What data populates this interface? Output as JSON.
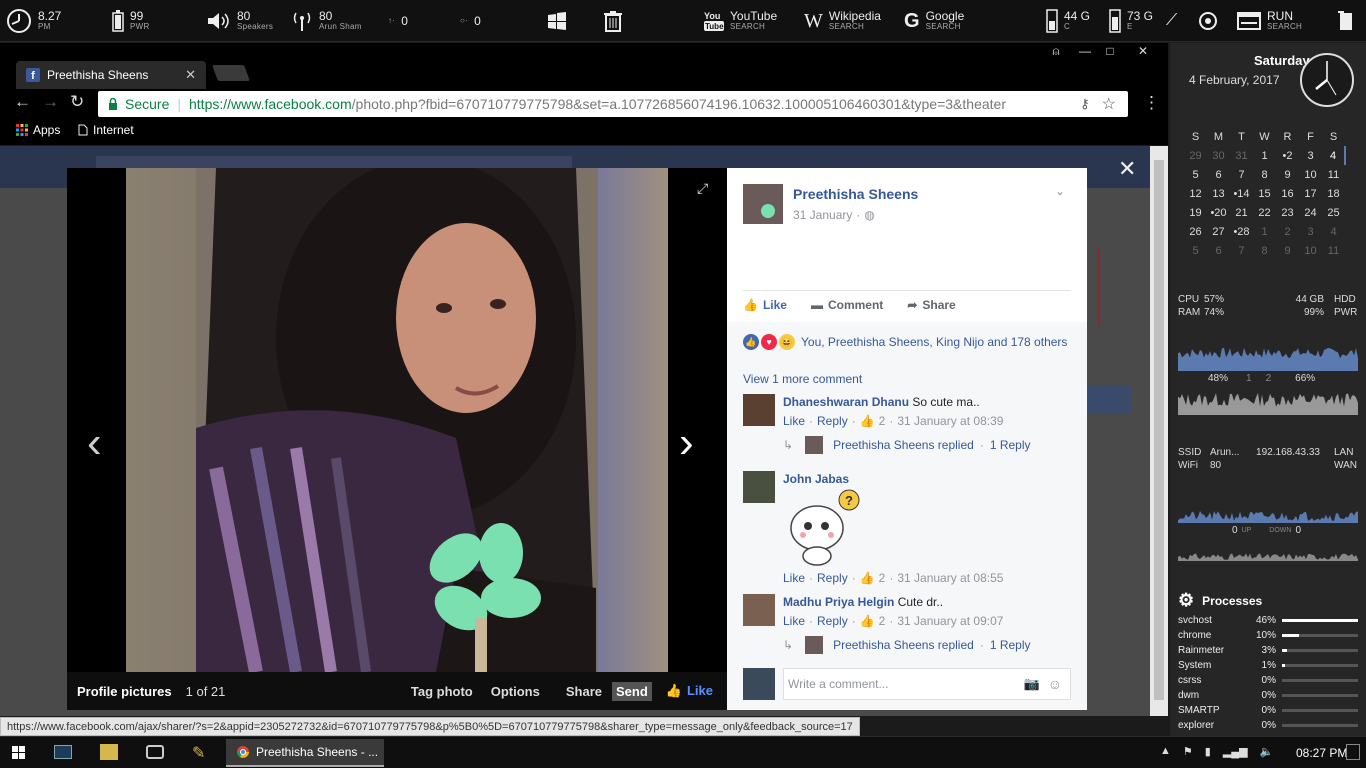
{
  "topbar": {
    "clock": {
      "value": "8.27",
      "sub": "PM"
    },
    "battery": {
      "value": "99",
      "sub": "PWR"
    },
    "volume": {
      "value": "80",
      "sub": "Speakers"
    },
    "wifi": {
      "value": "80",
      "sub": "Arun Sham"
    },
    "net_up": "0",
    "net_down": "0",
    "youtube": {
      "label": "YouTube",
      "sub": "SEARCH"
    },
    "wikipedia": {
      "label": "Wikipedia",
      "sub": "SEARCH"
    },
    "google": {
      "label": "Google",
      "sub": "SEARCH"
    },
    "drive_c": {
      "value": "44 G",
      "sub": "C"
    },
    "drive_e": {
      "value": "73 G",
      "sub": "E"
    },
    "run": {
      "label": "RUN",
      "sub": "SEARCH"
    }
  },
  "browser": {
    "tab_title": "Preethisha Sheens",
    "secure_label": "Secure",
    "url_host": "https://www.facebook.com",
    "url_path": "/photo.php?fbid=670710779775798&set=a.107726856074196.10632.100005106460301&type=3&theater",
    "bookmarks": {
      "apps": "Apps",
      "internet": "Internet"
    },
    "status_url": "https://www.facebook.com/ajax/sharer/?s=2&appid=2305272732&id=670710779775798&p%5B0%5D=670710779775798&sharer_type=message_only&feedback_source=17"
  },
  "photo": {
    "album": "Profile pictures",
    "counter": "1 of 21",
    "actions": {
      "tag": "Tag photo",
      "options": "Options",
      "share": "Share",
      "send": "Send",
      "like": "Like"
    }
  },
  "post": {
    "author": "Preethisha Sheens",
    "date": "31 January",
    "actions": {
      "like": "Like",
      "comment": "Comment",
      "share": "Share"
    },
    "reactions_text": "You, Preethisha Sheens, King Nijo and 178 others",
    "view_more": "View 1 more comment",
    "comments": [
      {
        "name": "Dhaneshwaran Dhanu",
        "text": "So cute ma..",
        "like": "Like",
        "reply": "Reply",
        "count": "2",
        "time": "31 January at 08:39",
        "replied": "Preethisha Sheens replied",
        "reply_count": "1 Reply"
      },
      {
        "name": "John Jabas",
        "text": "",
        "like": "Like",
        "reply": "Reply",
        "count": "2",
        "time": "31 January at 08:55"
      },
      {
        "name": "Madhu Priya Helgin",
        "text": "Cute dr..",
        "like": "Like",
        "reply": "Reply",
        "count": "2",
        "time": "31 January at 09:07",
        "replied": "Preethisha Sheens replied",
        "reply_count": "1 Reply"
      }
    ],
    "comment_placeholder": "Write a comment..."
  },
  "rainmeter": {
    "day": "Saturday",
    "date": "4 February, 2017",
    "calendar_head": [
      "S",
      "M",
      "T",
      "W",
      "R",
      "F",
      "S"
    ],
    "calendar_rows": [
      [
        "29",
        "30",
        "31",
        "1",
        "•2",
        "3",
        "4"
      ],
      [
        "5",
        "6",
        "7",
        "8",
        "9",
        "10",
        "11"
      ],
      [
        "12",
        "13",
        "•14",
        "15",
        "16",
        "17",
        "18"
      ],
      [
        "19",
        "•20",
        "21",
        "22",
        "23",
        "24",
        "25"
      ],
      [
        "26",
        "27",
        "•28",
        "1",
        "2",
        "3",
        "4"
      ],
      [
        "5",
        "6",
        "7",
        "8",
        "9",
        "10",
        "11"
      ]
    ],
    "cpu": {
      "label": "CPU",
      "value": "57%"
    },
    "ram": {
      "label": "RAM",
      "value": "74%"
    },
    "hdd": {
      "label": "HDD",
      "value": "44 GB"
    },
    "pwr": {
      "label": "PWR",
      "value": "99%"
    },
    "graph_left": "48%",
    "graph_mid1": "1",
    "graph_mid2": "2",
    "graph_right": "66%",
    "ssid": {
      "label": "SSID",
      "value": "Arun...",
      "ip": "192.168.43.33",
      "lan": "LAN"
    },
    "wifi": {
      "label": "WiFi",
      "value": "80",
      "wan": "WAN"
    },
    "up": {
      "value": "0",
      "label": "UP"
    },
    "down": {
      "value": "0",
      "label": "DOWN"
    },
    "processes_title": "Processes",
    "processes": [
      {
        "name": "svchost",
        "pct": "46%",
        "level": 0.46
      },
      {
        "name": "chrome",
        "pct": "10%",
        "level": 0.1
      },
      {
        "name": "Rainmeter",
        "pct": "3%",
        "level": 0.03
      },
      {
        "name": "System",
        "pct": "1%",
        "level": 0.01
      },
      {
        "name": "csrss",
        "pct": "0%",
        "level": 0
      },
      {
        "name": "dwm",
        "pct": "0%",
        "level": 0
      },
      {
        "name": "SMARTP",
        "pct": "0%",
        "level": 0
      },
      {
        "name": "explorer",
        "pct": "0%",
        "level": 0
      }
    ]
  },
  "taskbar": {
    "active_window": "Preethisha Sheens - ...",
    "time": "08:27 PM"
  }
}
